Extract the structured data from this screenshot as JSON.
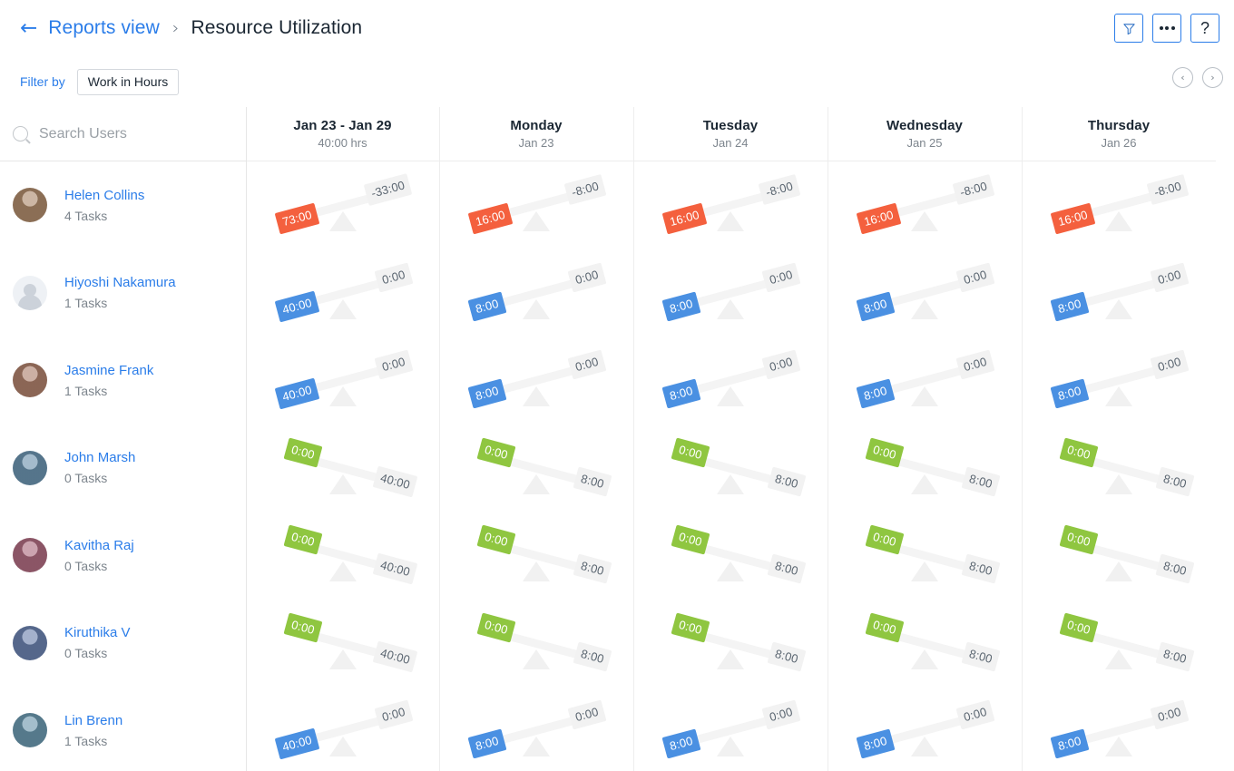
{
  "header": {
    "back_icon": "arrow-left-icon",
    "breadcrumb_parent": "Reports view",
    "breadcrumb_separator": "›",
    "breadcrumb_current": "Resource Utilization",
    "actions": {
      "filter": "filter-funnel-icon",
      "more": "more-options-icon",
      "help": "?"
    }
  },
  "filterbar": {
    "label": "Filter by",
    "chip": "Work in Hours",
    "prev_icon": "‹",
    "next_icon": "›"
  },
  "search": {
    "icon": "search-icon",
    "placeholder": "Search Users"
  },
  "columns": [
    {
      "title": "Jan 23 - Jan 29",
      "sub": "40:00 hrs",
      "kind": "week"
    },
    {
      "title": "Monday",
      "sub": "Jan 23",
      "kind": "day"
    },
    {
      "title": "Tuesday",
      "sub": "Jan 24",
      "kind": "day"
    },
    {
      "title": "Wednesday",
      "sub": "Jan 25",
      "kind": "day"
    },
    {
      "title": "Thursday",
      "sub": "Jan 26",
      "kind": "day"
    }
  ],
  "rows": [
    {
      "name": "Helen Collins",
      "tasks": "4 Tasks",
      "avatar": "photo",
      "cells": [
        {
          "tilt": "left",
          "color": "red",
          "left": "73:00",
          "right": "-33:00"
        },
        {
          "tilt": "left",
          "color": "red",
          "left": "16:00",
          "right": "-8:00"
        },
        {
          "tilt": "left",
          "color": "red",
          "left": "16:00",
          "right": "-8:00"
        },
        {
          "tilt": "left",
          "color": "red",
          "left": "16:00",
          "right": "-8:00"
        },
        {
          "tilt": "left",
          "color": "red",
          "left": "16:00",
          "right": "-8:00"
        }
      ]
    },
    {
      "name": "Hiyoshi Nakamura",
      "tasks": "1 Tasks",
      "avatar": "placeholder",
      "cells": [
        {
          "tilt": "left",
          "color": "blue",
          "left": "40:00",
          "right": "0:00"
        },
        {
          "tilt": "left",
          "color": "blue",
          "left": "8:00",
          "right": "0:00"
        },
        {
          "tilt": "left",
          "color": "blue",
          "left": "8:00",
          "right": "0:00"
        },
        {
          "tilt": "left",
          "color": "blue",
          "left": "8:00",
          "right": "0:00"
        },
        {
          "tilt": "left",
          "color": "blue",
          "left": "8:00",
          "right": "0:00"
        }
      ]
    },
    {
      "name": "Jasmine Frank",
      "tasks": "1 Tasks",
      "avatar": "photo",
      "cells": [
        {
          "tilt": "left",
          "color": "blue",
          "left": "40:00",
          "right": "0:00"
        },
        {
          "tilt": "left",
          "color": "blue",
          "left": "8:00",
          "right": "0:00"
        },
        {
          "tilt": "left",
          "color": "blue",
          "left": "8:00",
          "right": "0:00"
        },
        {
          "tilt": "left",
          "color": "blue",
          "left": "8:00",
          "right": "0:00"
        },
        {
          "tilt": "left",
          "color": "blue",
          "left": "8:00",
          "right": "0:00"
        }
      ]
    },
    {
      "name": "John Marsh",
      "tasks": "0 Tasks",
      "avatar": "photo",
      "cells": [
        {
          "tilt": "right",
          "color": "green",
          "left": "0:00",
          "right": "40:00"
        },
        {
          "tilt": "right",
          "color": "green",
          "left": "0:00",
          "right": "8:00"
        },
        {
          "tilt": "right",
          "color": "green",
          "left": "0:00",
          "right": "8:00"
        },
        {
          "tilt": "right",
          "color": "green",
          "left": "0:00",
          "right": "8:00"
        },
        {
          "tilt": "right",
          "color": "green",
          "left": "0:00",
          "right": "8:00"
        }
      ]
    },
    {
      "name": "Kavitha Raj",
      "tasks": "0 Tasks",
      "avatar": "photo",
      "cells": [
        {
          "tilt": "right",
          "color": "green",
          "left": "0:00",
          "right": "40:00"
        },
        {
          "tilt": "right",
          "color": "green",
          "left": "0:00",
          "right": "8:00"
        },
        {
          "tilt": "right",
          "color": "green",
          "left": "0:00",
          "right": "8:00"
        },
        {
          "tilt": "right",
          "color": "green",
          "left": "0:00",
          "right": "8:00"
        },
        {
          "tilt": "right",
          "color": "green",
          "left": "0:00",
          "right": "8:00"
        }
      ]
    },
    {
      "name": "Kiruthika V",
      "tasks": "0 Tasks",
      "avatar": "photo",
      "cells": [
        {
          "tilt": "right",
          "color": "green",
          "left": "0:00",
          "right": "40:00"
        },
        {
          "tilt": "right",
          "color": "green",
          "left": "0:00",
          "right": "8:00"
        },
        {
          "tilt": "right",
          "color": "green",
          "left": "0:00",
          "right": "8:00"
        },
        {
          "tilt": "right",
          "color": "green",
          "left": "0:00",
          "right": "8:00"
        },
        {
          "tilt": "right",
          "color": "green",
          "left": "0:00",
          "right": "8:00"
        }
      ]
    },
    {
      "name": "Lin Brenn",
      "tasks": "1 Tasks",
      "avatar": "photo",
      "cells": [
        {
          "tilt": "left",
          "color": "blue",
          "left": "40:00",
          "right": "0:00"
        },
        {
          "tilt": "left",
          "color": "blue",
          "left": "8:00",
          "right": "0:00"
        },
        {
          "tilt": "left",
          "color": "blue",
          "left": "8:00",
          "right": "0:00"
        },
        {
          "tilt": "left",
          "color": "blue",
          "left": "8:00",
          "right": "0:00"
        },
        {
          "tilt": "left",
          "color": "blue",
          "left": "8:00",
          "right": "0:00"
        }
      ]
    }
  ],
  "colors": {
    "over": "#f4603e",
    "full": "#4a90e2",
    "free": "#8fc640",
    "neutral": "#f2f2f2",
    "accent": "#2b7de9"
  }
}
